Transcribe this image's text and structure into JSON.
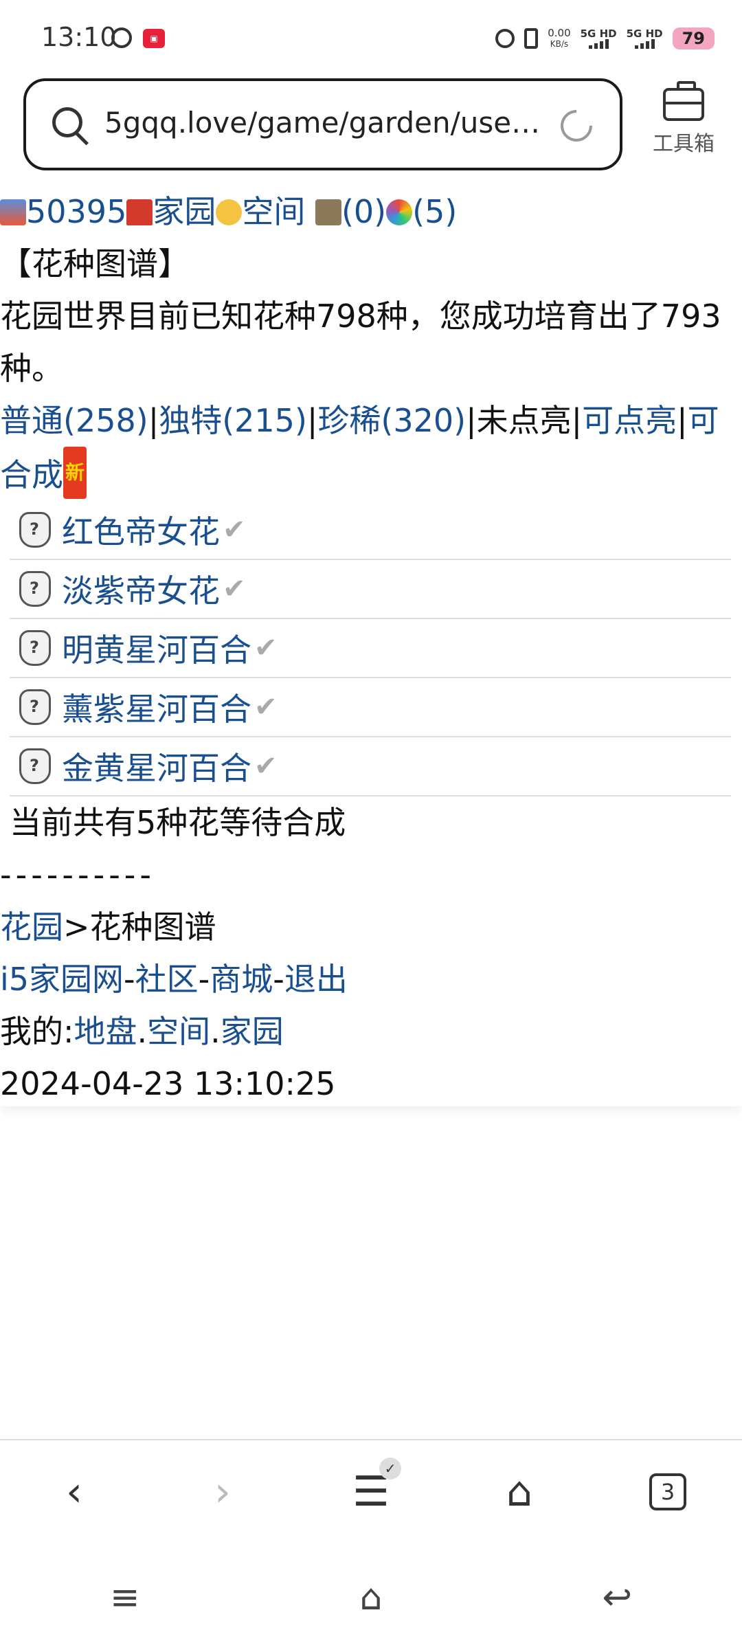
{
  "status": {
    "time": "13:10",
    "speed_value": "0.00",
    "speed_unit": "KB/s",
    "net1": "5G HD",
    "net2": "5G HD",
    "battery": "79"
  },
  "browser": {
    "url": "5gqq.love/game/garden/use…",
    "toolbox_label": "工具箱"
  },
  "page": {
    "top_links": {
      "id": "50395",
      "home": "家园",
      "space": "空间",
      "bank_count": "(0)",
      "wheel_count": "(5)"
    },
    "title": "【花种图谱】",
    "summary": "花园世界目前已知花种798种，您成功培育出了793种。",
    "filters": {
      "common": "普通(258)",
      "unique": "独特(215)",
      "rare": "珍稀(320)",
      "unlit": "未点亮",
      "lightable": "可点亮",
      "combinable": "可合成",
      "new_badge": "新",
      "sep": "|"
    },
    "flowers": [
      {
        "name": "红色帝女花"
      },
      {
        "name": "淡紫帝女花"
      },
      {
        "name": "明黄星河百合"
      },
      {
        "name": "薰紫星河百合"
      },
      {
        "name": "金黄星河百合"
      }
    ],
    "waiting": "当前共有5种花等待合成",
    "divider": "----------",
    "crumb_link": "花园",
    "crumb_current": ">花种图谱",
    "footer_links": {
      "site": "i5家园网",
      "community": "社区",
      "mall": "商城",
      "logout": "退出",
      "dash": "-"
    },
    "mine_label": "我的:",
    "mine_links": {
      "land": "地盘",
      "space": "空间",
      "home": "家园",
      "dot": "."
    },
    "timestamp": "2024-04-23 13:10:25"
  },
  "bottom_nav": {
    "tab_count": "3"
  }
}
